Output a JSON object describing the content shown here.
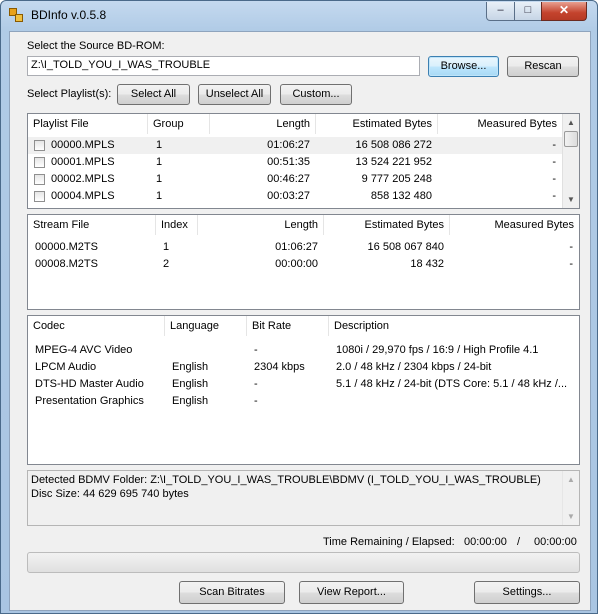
{
  "window": {
    "title": "BDInfo v.0.5.8",
    "controls": {
      "minimize": "–",
      "maximize": "□",
      "close": "✕"
    }
  },
  "source": {
    "label": "Select the Source BD-ROM:",
    "path": "Z:\\I_TOLD_YOU_I_WAS_TROUBLE",
    "browse": "Browse...",
    "rescan": "Rescan"
  },
  "playlist_controls": {
    "label": "Select Playlist(s):",
    "select_all": "Select All",
    "unselect_all": "Unselect All",
    "custom": "Custom..."
  },
  "playlists": {
    "headers": [
      "Playlist File",
      "Group",
      "Length",
      "Estimated Bytes",
      "Measured Bytes"
    ],
    "rows": [
      {
        "file": "00000.MPLS",
        "group": "1",
        "length": "01:06:27",
        "estimated": "16 508 086 272",
        "measured": "-"
      },
      {
        "file": "00001.MPLS",
        "group": "1",
        "length": "00:51:35",
        "estimated": "13 524 221 952",
        "measured": "-"
      },
      {
        "file": "00002.MPLS",
        "group": "1",
        "length": "00:46:27",
        "estimated": "9 777 205 248",
        "measured": "-"
      },
      {
        "file": "00004.MPLS",
        "group": "1",
        "length": "00:03:27",
        "estimated": "858 132 480",
        "measured": "-"
      }
    ]
  },
  "streams": {
    "headers": [
      "Stream File",
      "Index",
      "Length",
      "Estimated Bytes",
      "Measured Bytes"
    ],
    "rows": [
      {
        "file": "00000.M2TS",
        "index": "1",
        "length": "01:06:27",
        "estimated": "16 508 067 840",
        "measured": "-"
      },
      {
        "file": "00008.M2TS",
        "index": "2",
        "length": "00:00:00",
        "estimated": "18 432",
        "measured": "-"
      }
    ]
  },
  "codecs": {
    "headers": [
      "Codec",
      "Language",
      "Bit Rate",
      "Description"
    ],
    "rows": [
      {
        "codec": "MPEG-4 AVC Video",
        "language": "",
        "bitrate": "-",
        "description": "1080i / 29,970 fps / 16:9 / High Profile 4.1"
      },
      {
        "codec": "LPCM Audio",
        "language": "English",
        "bitrate": "2304 kbps",
        "description": "2.0 / 48 kHz / 2304 kbps / 24-bit"
      },
      {
        "codec": "DTS-HD Master Audio",
        "language": "English",
        "bitrate": "-",
        "description": "5.1 / 48 kHz / 24-bit (DTS Core: 5.1 / 48 kHz /..."
      },
      {
        "codec": "Presentation Graphics",
        "language": "English",
        "bitrate": "-",
        "description": ""
      }
    ]
  },
  "info": {
    "line1": "Detected BDMV Folder: Z:\\I_TOLD_YOU_I_WAS_TROUBLE\\BDMV (I_TOLD_YOU_I_WAS_TROUBLE)",
    "line2": "Disc Size: 44 629 695 740 bytes"
  },
  "timing": {
    "label": "Time Remaining / Elapsed:",
    "remaining": "00:00:00",
    "separator": "/",
    "elapsed": "00:00:00"
  },
  "progress": {
    "value": 0
  },
  "footer": {
    "scan": "Scan Bitrates",
    "report": "View Report...",
    "settings": "Settings..."
  }
}
